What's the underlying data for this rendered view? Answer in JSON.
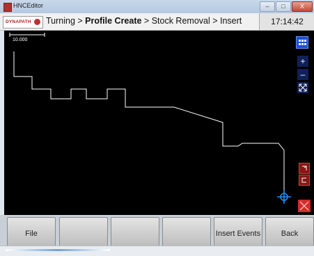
{
  "window": {
    "title": "HNCEditor",
    "buttons": {
      "minimize": "–",
      "maximize": "□",
      "close": "X"
    }
  },
  "logo": {
    "text": "DYNAPATH"
  },
  "breadcrumb": {
    "part1": "Turning > ",
    "part2": "Profile Create",
    "part3": " > Stock Removal > Insert"
  },
  "clock": "17:14:42",
  "viewport": {
    "scale_label": "10.000"
  },
  "tools": {
    "grid": "grid-icon",
    "zoom_in": "+",
    "zoom_out": "–",
    "fit": "fit-icon"
  },
  "function_keys": [
    "File",
    "",
    "",
    "",
    "Insert Events",
    "Back"
  ],
  "colors": {
    "canvas": "#000000",
    "profile": "#ffffff",
    "accent_blue": "#1a4fd6",
    "cursor": "#1e90ff",
    "danger": "#b22222"
  }
}
